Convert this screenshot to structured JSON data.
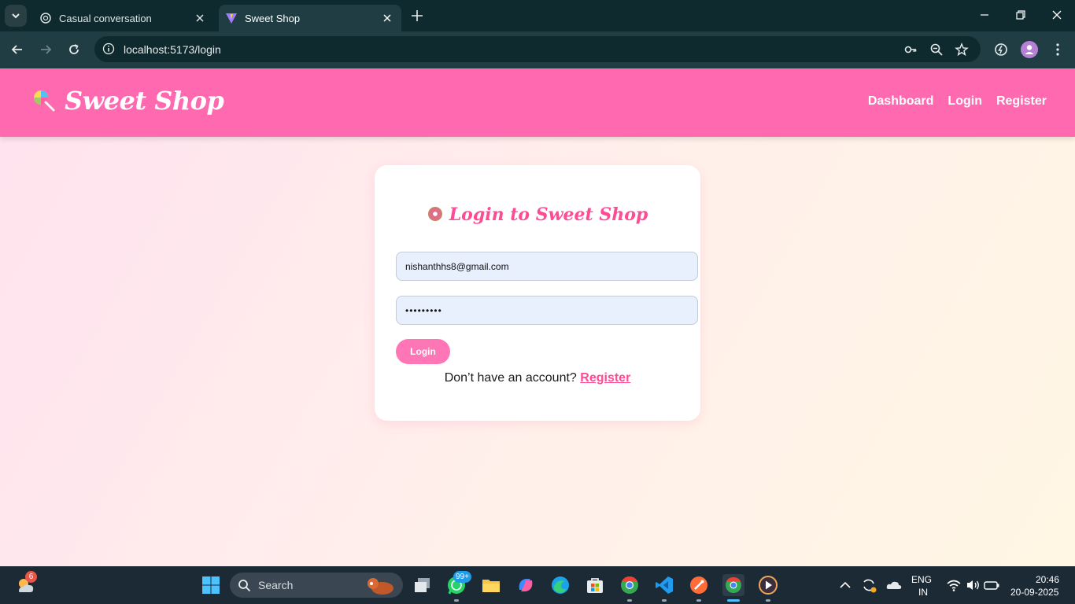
{
  "browser": {
    "tabs": [
      {
        "title": "Casual conversation",
        "active": false
      },
      {
        "title": "Sweet Shop",
        "active": true
      }
    ],
    "url": "localhost:5173/login"
  },
  "page": {
    "brand": "Sweet Shop",
    "nav": [
      "Dashboard",
      "Login",
      "Register"
    ],
    "form": {
      "title": "Login to Sweet Shop",
      "email_value": "nishanthhs8@gmail.com",
      "password_value": "•••••••••",
      "login_label": "Login",
      "register_prompt": "Don’t have an account?",
      "register_link": "Register"
    }
  },
  "taskbar": {
    "search_label": "Search",
    "weather_badge": "6",
    "whatsapp_badge": "99+",
    "language": "ENG",
    "region": "IN",
    "time": "20:46",
    "date": "20-09-2025"
  },
  "colors": {
    "header": "#ff69b0",
    "accent": "#ff4b94",
    "button": "#ff76b6"
  }
}
